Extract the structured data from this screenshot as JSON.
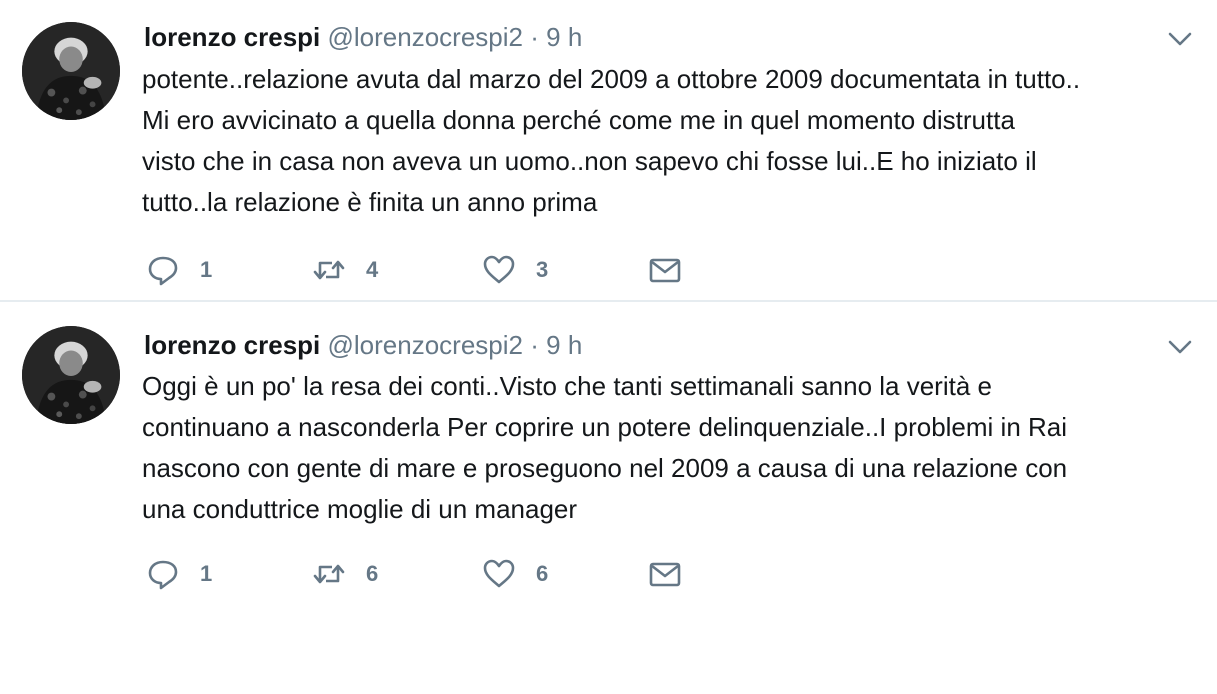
{
  "tweets": [
    {
      "fullname": "lorenzo crespi",
      "handle": "@lorenzocrespi2",
      "separator": "·",
      "time": "9 h",
      "lines": [
        "potente..relazione avuta dal marzo del 2009 a ottobre 2009 documentata in tutto..",
        "Mi ero avvicinato a quella donna perché come me in quel momento distrutta",
        "visto che in casa non aveva un uomo..non sapevo chi fosse lui..E ho iniziato il",
        "tutto..la relazione è finita un anno prima"
      ],
      "replies": "1",
      "retweets": "4",
      "likes": "3"
    },
    {
      "fullname": "lorenzo crespi",
      "handle": "@lorenzocrespi2",
      "separator": "·",
      "time": "9 h",
      "lines": [
        "Oggi è un po' la resa dei conti..Visto che tanti settimanali sanno la verità e",
        "continuano a nasconderla Per coprire un potere delinquenziale..I problemi in Rai",
        "nascono con gente di mare e proseguono nel 2009 a causa di una relazione con",
        "una conduttrice moglie di un manager"
      ],
      "replies": "1",
      "retweets": "6",
      "likes": "6"
    }
  ],
  "icons": {
    "reply": "reply-icon",
    "retweet": "retweet-icon",
    "like": "heart-icon",
    "dm": "envelope-icon",
    "caret": "chevron-down-icon"
  },
  "colors": {
    "text": "#14171a",
    "secondary": "#657786",
    "divider": "#e6ecf0"
  }
}
